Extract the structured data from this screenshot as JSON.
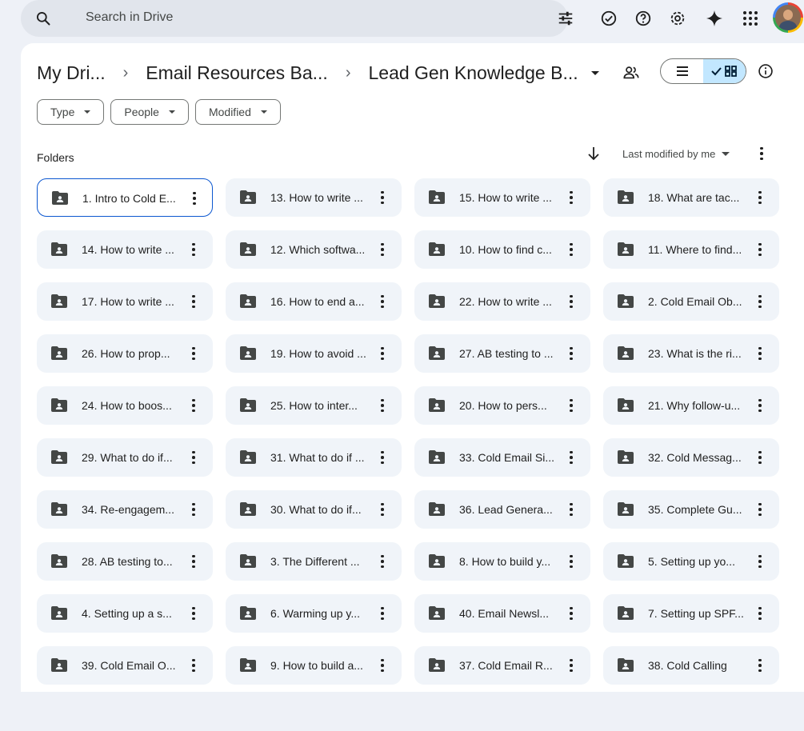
{
  "search": {
    "placeholder": "Search in Drive"
  },
  "topbar_icons": [
    "search-icon",
    "tune-icon",
    "offline-check-icon",
    "help-icon",
    "settings-icon",
    "gemini-spark-icon",
    "apps-grid-icon",
    "avatar"
  ],
  "breadcrumb": {
    "items": [
      "My Dri...",
      "Email Resources Ba...",
      "Lead Gen Knowledge B..."
    ]
  },
  "view_toggle": {
    "active": "grid"
  },
  "filters": [
    {
      "label": "Type"
    },
    {
      "label": "People"
    },
    {
      "label": "Modified"
    }
  ],
  "section": {
    "title": "Folders"
  },
  "sort": {
    "label": "Last modified by me"
  },
  "folders": [
    {
      "name": "1. Intro to Cold E...",
      "selected": true
    },
    {
      "name": "13. How to write ..."
    },
    {
      "name": "15. How to write ..."
    },
    {
      "name": "18. What are tac..."
    },
    {
      "name": "14. How to write ..."
    },
    {
      "name": "12. Which softwa..."
    },
    {
      "name": "10. How to find c..."
    },
    {
      "name": "11. Where to find..."
    },
    {
      "name": "17. How to write ..."
    },
    {
      "name": "16. How to end a..."
    },
    {
      "name": "22. How to write ..."
    },
    {
      "name": "2. Cold Email Ob..."
    },
    {
      "name": "26. How to prop..."
    },
    {
      "name": "19. How to avoid ..."
    },
    {
      "name": "27. AB testing to ..."
    },
    {
      "name": "23. What is the ri..."
    },
    {
      "name": "24. How to boos..."
    },
    {
      "name": "25. How to inter..."
    },
    {
      "name": "20. How to pers..."
    },
    {
      "name": "21. Why follow-u..."
    },
    {
      "name": "29. What to do if..."
    },
    {
      "name": "31. What to do if ..."
    },
    {
      "name": "33. Cold Email Si..."
    },
    {
      "name": "32. Cold Messag..."
    },
    {
      "name": "34. Re-engagem..."
    },
    {
      "name": "30. What to do if..."
    },
    {
      "name": "36. Lead Genera..."
    },
    {
      "name": "35. Complete Gu..."
    },
    {
      "name": "28. AB testing to..."
    },
    {
      "name": "3. The Different ..."
    },
    {
      "name": "8. How to build y..."
    },
    {
      "name": "5. Setting up yo..."
    },
    {
      "name": "4. Setting up a s..."
    },
    {
      "name": "6. Warming up y..."
    },
    {
      "name": "40. Email Newsl..."
    },
    {
      "name": "7. Setting up SPF..."
    },
    {
      "name": "39. Cold Email O..."
    },
    {
      "name": "9. How to build a..."
    },
    {
      "name": "37. Cold Email R..."
    },
    {
      "name": "38. Cold Calling"
    }
  ],
  "colors": {
    "accent": "#0b57d0",
    "selected_toggle": "#c2e7ff",
    "folder_icon": "#444746"
  }
}
